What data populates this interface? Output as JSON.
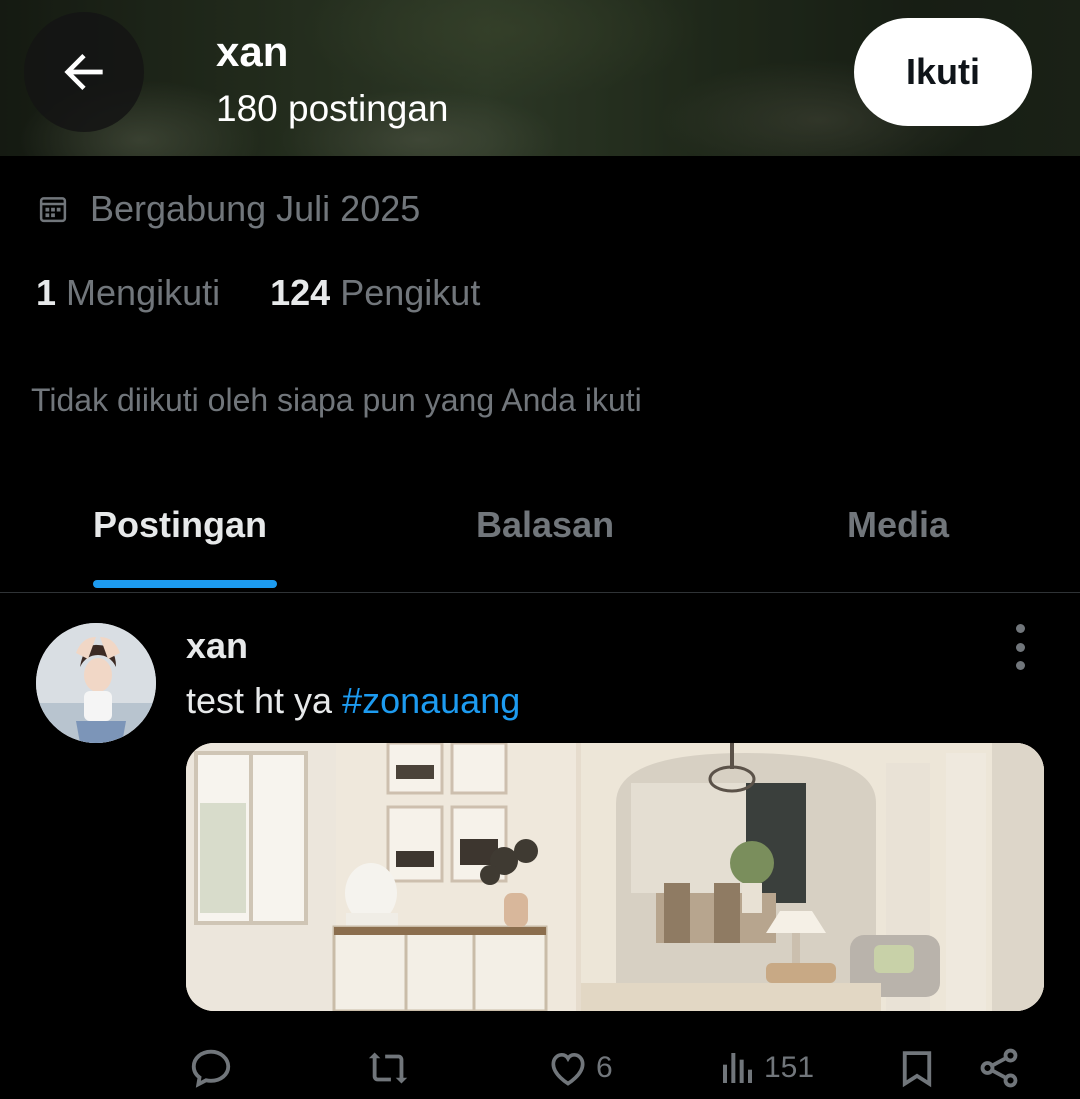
{
  "header": {
    "title": "xan",
    "subtitle": "180 postingan",
    "follow_label": "Ikuti"
  },
  "profile": {
    "joined": "Bergabung Juli 2025",
    "following_count": "1",
    "following_label": "Mengikuti",
    "followers_count": "124",
    "followers_label": "Pengikut",
    "mutuals_text": "Tidak diikuti oleh siapa pun yang Anda ikuti"
  },
  "tabs": [
    {
      "label": "Postingan",
      "active": true
    },
    {
      "label": "Balasan",
      "active": false
    },
    {
      "label": "Media",
      "active": false
    }
  ],
  "post": {
    "author": "xan",
    "text": "test ht ya ",
    "hashtag": "#zonauang",
    "likes": "6",
    "views": "151"
  },
  "colors": {
    "accent": "#1d9bf0",
    "muted": "#71767b",
    "background": "#000000",
    "text": "#e7e9ea"
  }
}
